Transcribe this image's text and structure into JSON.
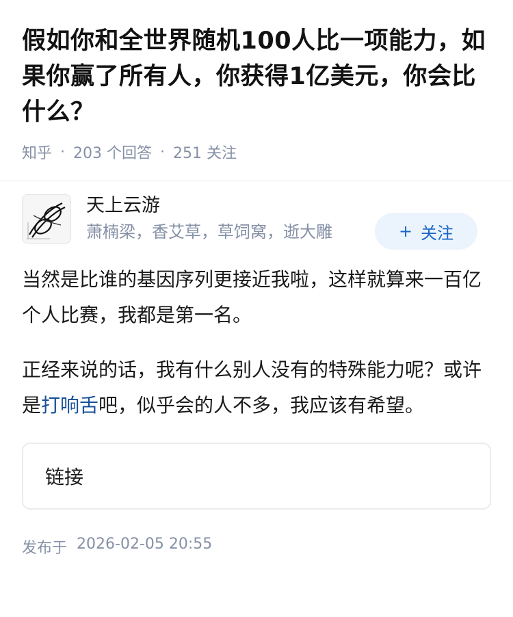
{
  "question": {
    "title": "假如你和全世界随机100人比一项能力，如果你赢了所有人，你获得1亿美元，你会比什么？",
    "source": "知乎",
    "answer_count": "203 个回答",
    "follow_count": "251 关注"
  },
  "answer": {
    "author": {
      "name": "天上云游",
      "badge": "萧楠梁，香艾草，草饲窝，逝大雕",
      "avatar_icon": "sketch-avatar-icon"
    },
    "follow_button": {
      "plus": "+",
      "label": "关注"
    },
    "paragraph1": "当然是比谁的基因序列更接近我啦，这样就算来一百亿个人比赛，我都是第一名。",
    "paragraph2_before": "正经来说的话，我有什么别人没有的特殊能力呢？或许是",
    "paragraph2_link": "打响舌",
    "paragraph2_after": "吧，似乎会的人不多，我应该有希望。",
    "link_card_label": "链接",
    "publish_prefix": "发布于",
    "publish_time": "2026-02-05 20:55"
  },
  "colors": {
    "meta_gray": "#8590a6",
    "link_blue": "#175199",
    "follow_bg": "#ebf3fc",
    "follow_text": "#1966c6"
  }
}
